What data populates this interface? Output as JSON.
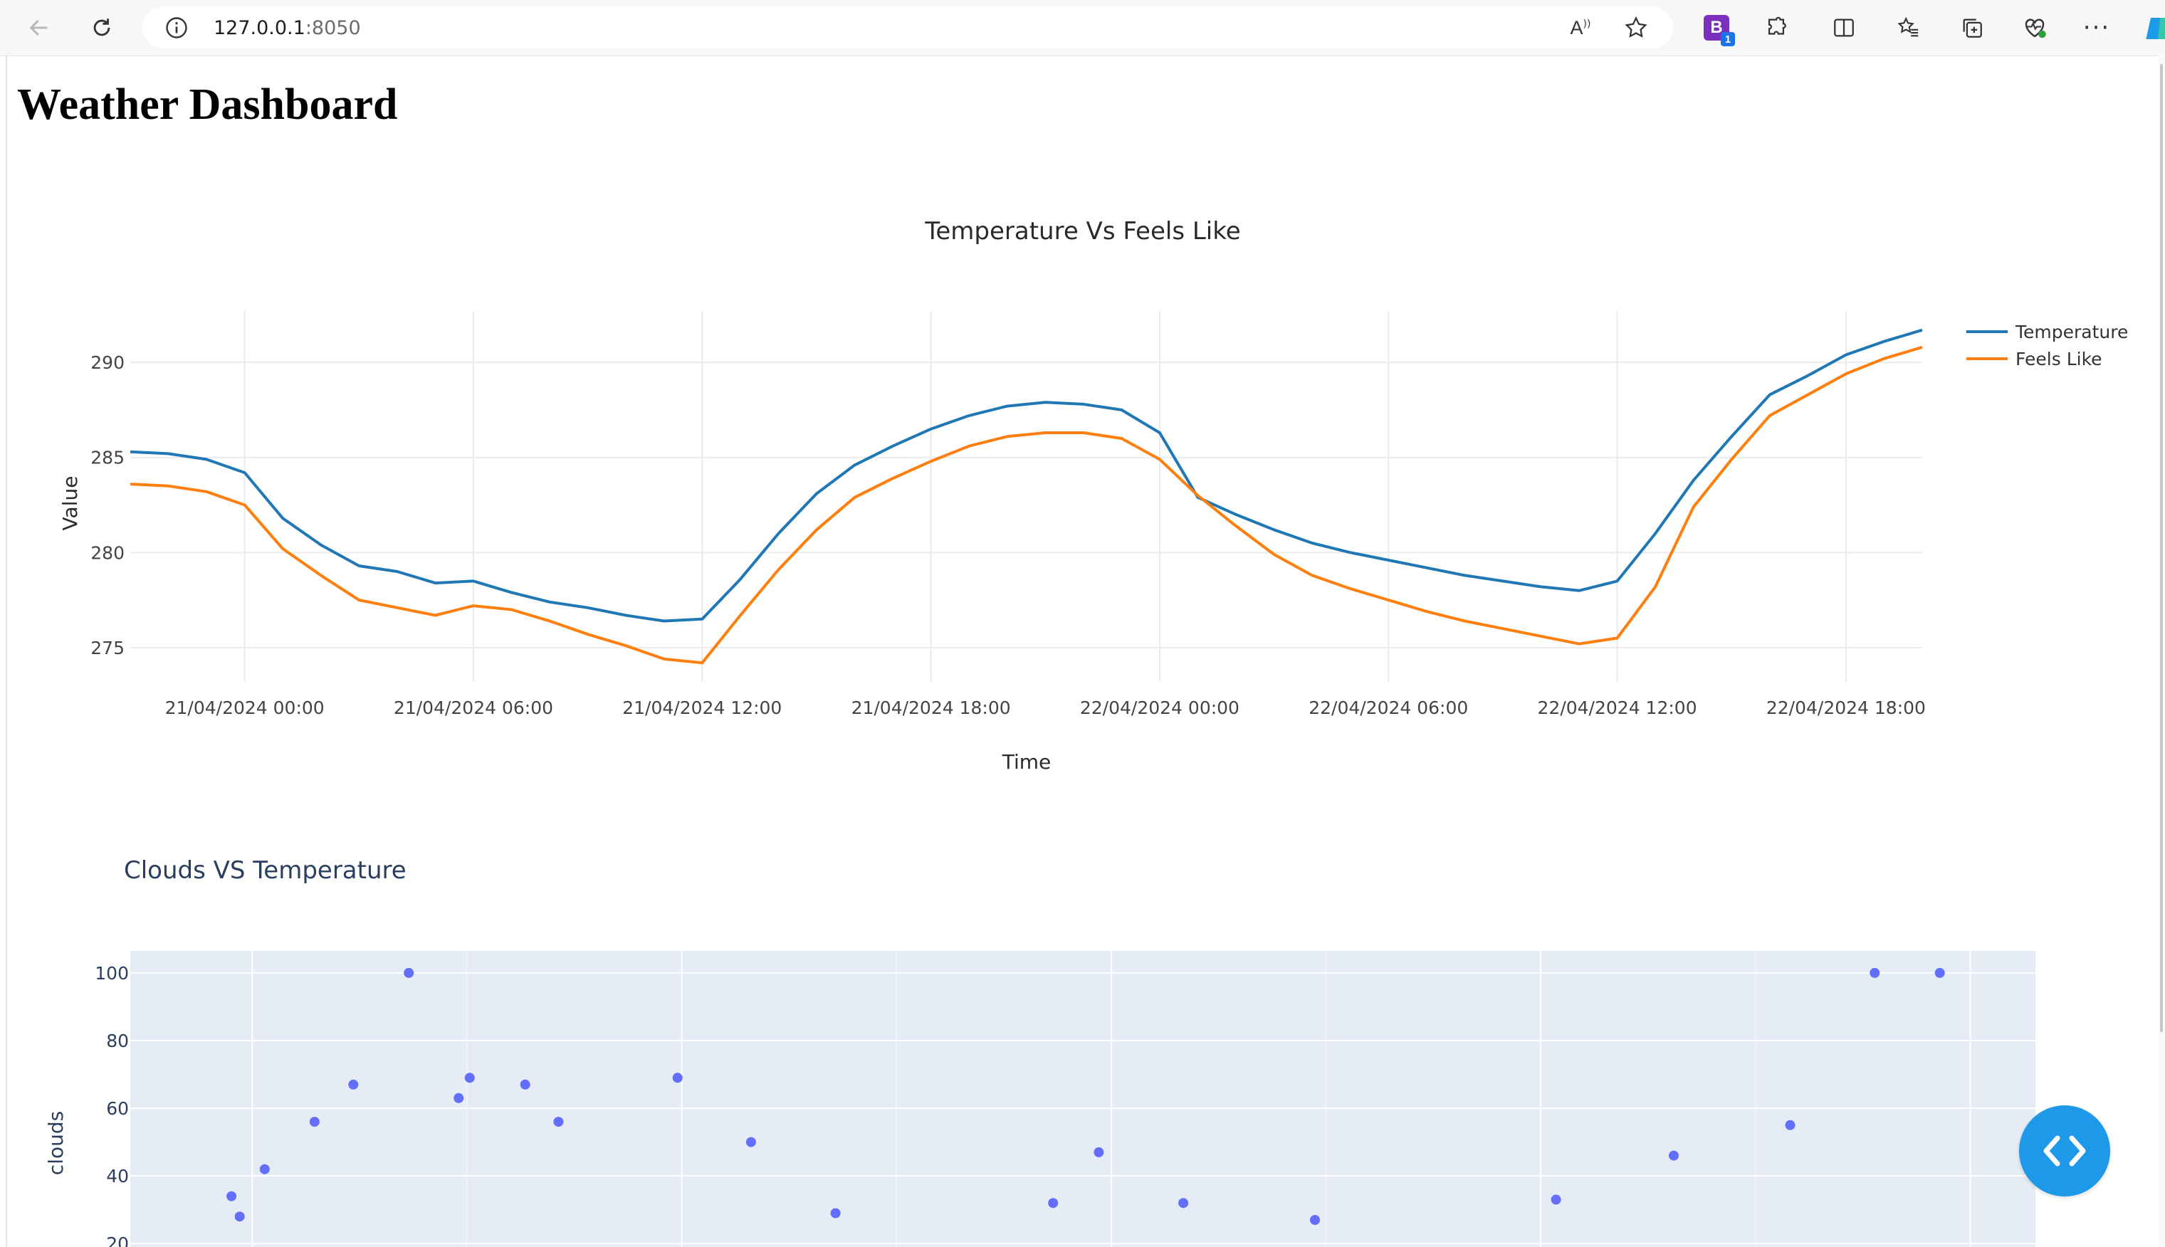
{
  "browser": {
    "url_host": "127.0.0.1",
    "url_port": ":8050",
    "extension_badge": "B",
    "extension_count": "1",
    "read_aloud": "A",
    "menu_label": "···"
  },
  "page": {
    "title": "Weather Dashboard"
  },
  "chart_data": [
    {
      "type": "line",
      "title": "Temperature Vs Feels Like",
      "xlabel": "Time",
      "ylabel": "Value",
      "x_ticks": [
        "21/04/2024 00:00",
        "21/04/2024 06:00",
        "21/04/2024 12:00",
        "21/04/2024 18:00",
        "22/04/2024 00:00",
        "22/04/2024 06:00",
        "22/04/2024 12:00",
        "22/04/2024 18:00"
      ],
      "y_ticks": [
        275,
        280,
        285,
        290
      ],
      "ylim": [
        273.2,
        292.7
      ],
      "xlim_hours": [
        -3,
        44
      ],
      "legend_position": "top-right",
      "grid": true,
      "x_hours": [
        -3,
        -2,
        -1,
        0,
        1,
        2,
        3,
        4,
        5,
        6,
        7,
        8,
        9,
        10,
        11,
        12,
        13,
        14,
        15,
        16,
        17,
        18,
        19,
        20,
        21,
        22,
        23,
        24,
        25,
        26,
        27,
        28,
        29,
        30,
        31,
        32,
        33,
        34,
        35,
        36,
        37,
        38,
        39,
        40,
        41,
        42,
        43,
        44
      ],
      "series": [
        {
          "name": "Temperature",
          "color": "#1f77b4",
          "values": [
            285.3,
            285.2,
            284.9,
            284.2,
            281.8,
            280.4,
            279.3,
            279.0,
            278.4,
            278.5,
            277.9,
            277.4,
            277.1,
            276.7,
            276.4,
            276.5,
            278.6,
            281.0,
            283.1,
            284.6,
            285.6,
            286.5,
            287.2,
            287.7,
            287.9,
            287.8,
            287.5,
            286.3,
            282.9,
            282.0,
            281.2,
            280.5,
            280.0,
            279.6,
            279.2,
            278.8,
            278.5,
            278.2,
            278.0,
            278.5,
            281.0,
            283.8,
            286.1,
            288.3,
            289.3,
            290.4,
            291.1,
            291.7
          ]
        },
        {
          "name": "Feels Like",
          "color": "#ff7f0e",
          "values": [
            283.6,
            283.5,
            283.2,
            282.5,
            280.2,
            278.8,
            277.5,
            277.1,
            276.7,
            277.2,
            277.0,
            276.4,
            275.7,
            275.1,
            274.4,
            274.2,
            276.7,
            279.1,
            281.2,
            282.9,
            283.9,
            284.8,
            285.6,
            286.1,
            286.3,
            286.3,
            286.0,
            284.9,
            283.0,
            281.4,
            279.9,
            278.8,
            278.1,
            277.5,
            276.9,
            276.4,
            276.0,
            275.6,
            275.2,
            275.5,
            278.2,
            282.4,
            284.9,
            287.2,
            288.3,
            289.4,
            290.2,
            290.8
          ]
        }
      ]
    },
    {
      "type": "scatter",
      "title": "Clouds VS Temperature",
      "ylabel": "clouds",
      "y_ticks": [
        20,
        40,
        60,
        80,
        100
      ],
      "ylim": [
        19,
        106.5
      ],
      "xlim": [
        0,
        1375
      ],
      "grid": true,
      "marker_color": "#636efa",
      "x": [
        73,
        79,
        97,
        133,
        161,
        201,
        237,
        245,
        285,
        309,
        395,
        448,
        509,
        666,
        699,
        760,
        855,
        1029,
        1114,
        1198,
        1259,
        1306
      ],
      "y": [
        34,
        28,
        42,
        56,
        67,
        100,
        63,
        69,
        67,
        56,
        69,
        50,
        29,
        32,
        47,
        32,
        27,
        33,
        46,
        55,
        100,
        100
      ]
    }
  ]
}
